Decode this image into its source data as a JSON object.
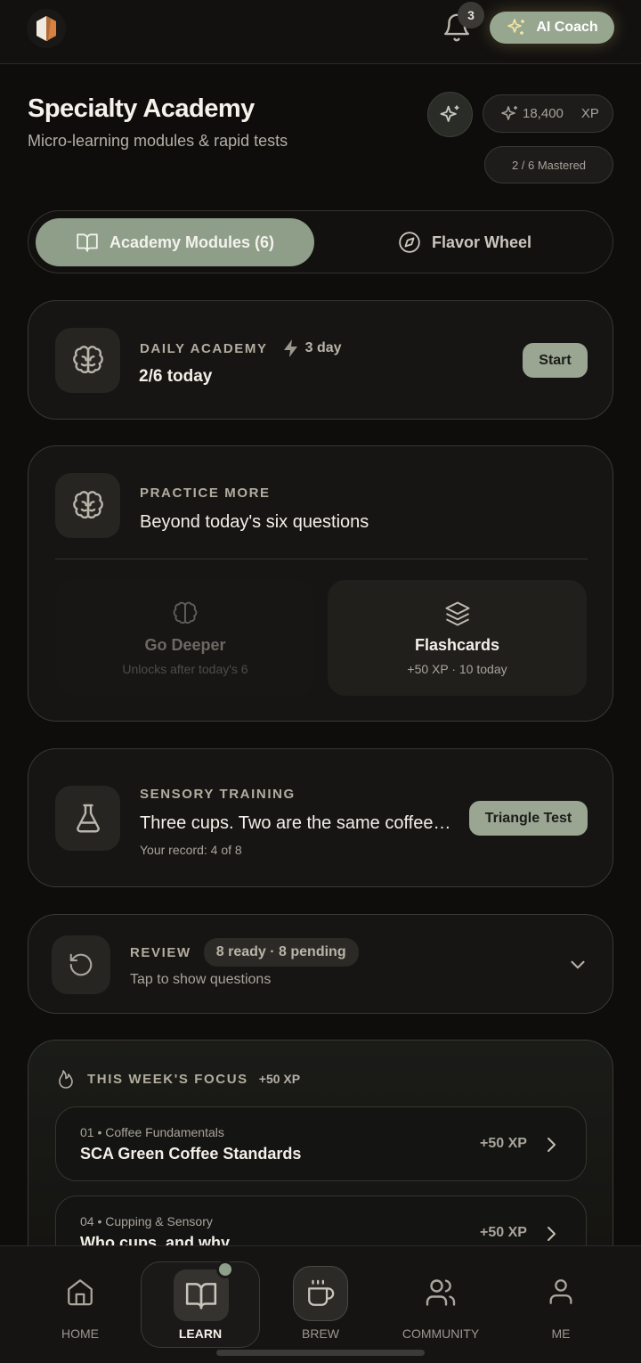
{
  "topbar": {
    "notifications_count": "3",
    "coach_label": "AI Coach"
  },
  "header": {
    "title": "Specialty Academy",
    "subtitle": "Micro-learning modules & rapid tests",
    "xp_value": "18,400",
    "xp_unit": "XP",
    "mastered": "2 / 6 Mastered"
  },
  "tabs": [
    {
      "label": "Academy Modules (6)",
      "active": true
    },
    {
      "label": "Flavor Wheel",
      "active": false
    }
  ],
  "daily": {
    "kicker": "DAILY ACADEMY",
    "streak": "3 day",
    "progress": "2/6 today",
    "button": "Start"
  },
  "practice": {
    "kicker": "PRACTICE MORE",
    "title": "Beyond today's six questions",
    "options": [
      {
        "title": "Go Deeper",
        "subtitle": "Unlocks after today's 6",
        "locked": true
      },
      {
        "title": "Flashcards",
        "subtitle": "+50 XP · 10 today",
        "locked": false
      }
    ]
  },
  "sensory": {
    "kicker": "SENSORY TRAINING",
    "title": "Three cups. Two are the same coffee. Find the odd one.",
    "record": "Your record: 4 of 8",
    "button": "Triangle Test"
  },
  "review": {
    "kicker": "REVIEW",
    "badge": "8 ready · 8 pending",
    "hint": "Tap to show questions"
  },
  "focus": {
    "kicker": "THIS WEEK'S FOCUS",
    "bonus": "+50 XP",
    "items": [
      {
        "meta": "01 • Coffee Fundamentals",
        "title": "SCA Green Coffee Standards",
        "xp": "+50 XP"
      },
      {
        "meta": "04 • Cupping & Sensory",
        "title": "Who cups, and why",
        "xp": "+50 XP"
      }
    ]
  },
  "nav": [
    {
      "label": "HOME",
      "active": false
    },
    {
      "label": "LEARN",
      "active": true
    },
    {
      "label": "BREW",
      "active": false
    },
    {
      "label": "COMMUNITY",
      "active": false
    },
    {
      "label": "ME",
      "active": false
    }
  ],
  "colors": {
    "background": "#0e0d0b",
    "accent_sage": "#8e9e88",
    "card_border": "#3a3834",
    "text_primary": "#ece8e1",
    "text_muted": "#b4afa6",
    "notification_dot": "#8ea08a"
  },
  "icons": {
    "logo": "hexagon-logo-icon",
    "notifications": "bell-icon",
    "coach": "sparkles-icon",
    "daily": "brain-icon",
    "streak": "lightning-icon",
    "practice": "brain-icon",
    "go_deeper": "brain-icon",
    "flashcards": "layers-icon",
    "sensory": "flask-icon",
    "review": "refresh-icon",
    "expand": "chevron-down-icon",
    "focus": "flame-icon",
    "row": "chevron-right-icon",
    "home": "home-icon",
    "learn": "book-icon",
    "brew": "coffee-cup-icon",
    "community": "users-icon",
    "me": "user-icon"
  }
}
